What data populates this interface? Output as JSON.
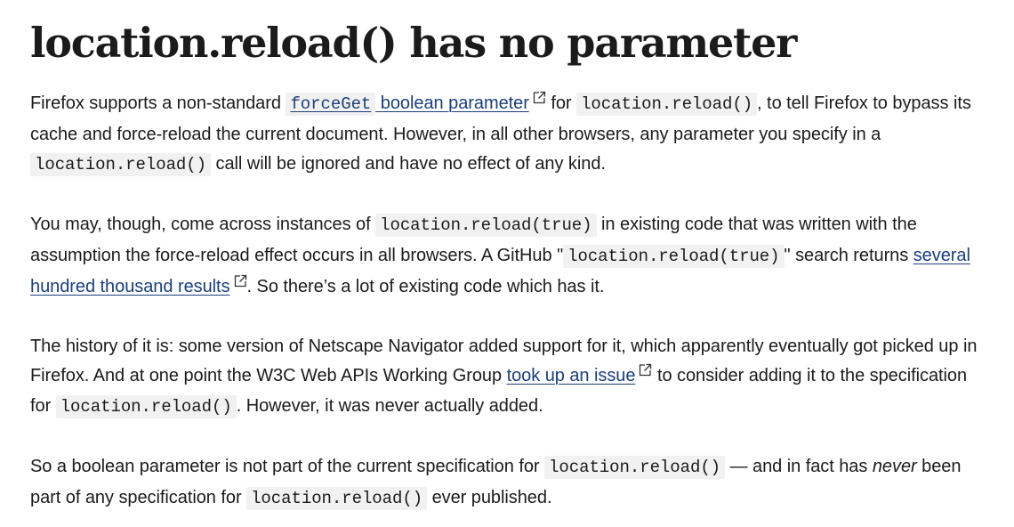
{
  "article": {
    "title": "location.reload() has no parameter",
    "paragraphs": {
      "p1": {
        "t1": "Firefox supports a non-standard ",
        "link_code": "forceGet",
        "link_text": " boolean parameter",
        "t2": " for ",
        "code1": "location.reload()",
        "t3": ", to tell Firefox to bypass its cache and force-reload the current document. However, in all other browsers, any parameter you specify in a ",
        "code2": "location.reload()",
        "t4": " call will be ignored and have no effect of any kind."
      },
      "p2": {
        "t1": "You may, though, come across instances of ",
        "code1": "location.reload(true)",
        "t2": " in existing code that was written with the assumption the force-reload effect occurs in all browsers. A GitHub \"",
        "code2": "location.reload(true)",
        "t3": "\" search returns ",
        "link_text": "several hundred thousand results",
        "t4": ". So there’s a lot of existing code which has it."
      },
      "p3": {
        "t1": "The history of it is: some version of Netscape Navigator added support for it, which apparently eventually got picked up in Firefox. And at one point the W3C Web APIs Working Group ",
        "link_text": "took up an issue",
        "t2": " to consider adding it to the specification for ",
        "code1": "location.reload()",
        "t3": ". However, it was never actually added."
      },
      "p4": {
        "t1": "So a boolean parameter is not part of the current specification for ",
        "code1": "location.reload()",
        "t2": " — and in fact has ",
        "em": "never",
        "t3": " been part of any specification for ",
        "code2": "location.reload()",
        "t4": " ever published."
      }
    }
  },
  "icons": {
    "external_link": "external-link-icon"
  },
  "colors": {
    "link": "#1a3e7a",
    "text": "#1b1b1b",
    "code_bg": "#f2f1f1"
  }
}
